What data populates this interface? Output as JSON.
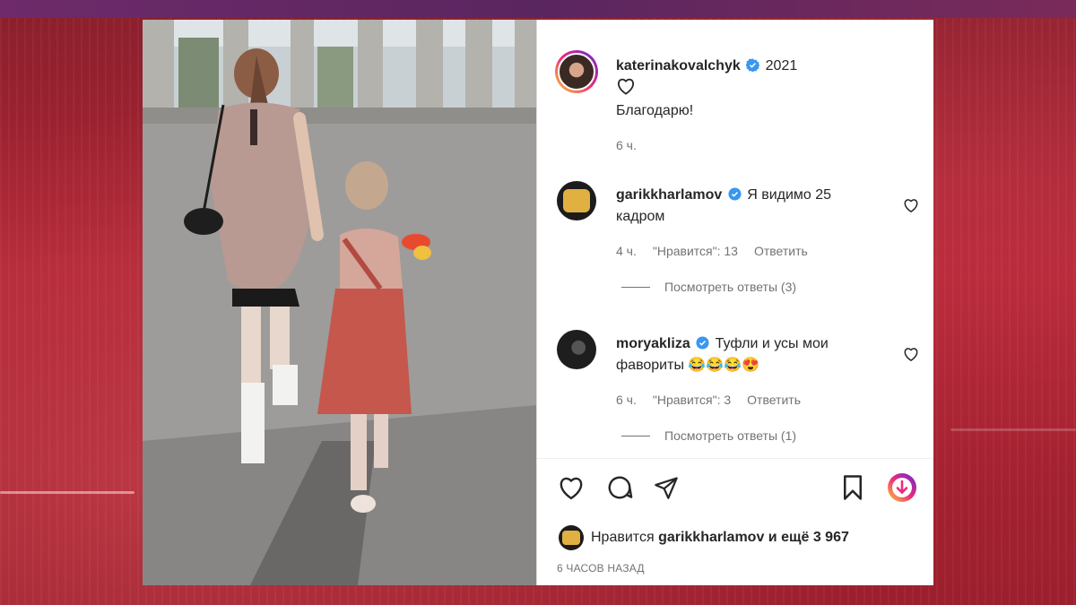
{
  "caption": {
    "username": "katerinakovalchyk",
    "year_text": "2021",
    "text": "Благодарю!",
    "time": "6 ч."
  },
  "comments": [
    {
      "username": "garikkharlamov",
      "text_line1": "Я видимо 25",
      "text_line2": "кадром",
      "time": "4 ч.",
      "likes": "\"Нравится\": 13",
      "reply": "Ответить",
      "view_replies": "Посмотреть ответы (3)"
    },
    {
      "username": "moryakliza",
      "text_line1": "Туфли и усы мои",
      "text_line2": "фавориты 😂😂😂😍",
      "time": "6 ч.",
      "likes": "\"Нравится\": 3",
      "reply": "Ответить",
      "view_replies": "Посмотреть ответы (1)"
    }
  ],
  "likes_bar": {
    "prefix": "Нравится",
    "user": "garikkharlamov",
    "suffix": "и ещё 3 967"
  },
  "timestamp": "6 ЧАСОВ НАЗАД",
  "icons": [
    "like-icon",
    "comment-icon",
    "share-icon",
    "bookmark-icon",
    "download-icon",
    "verified-icon"
  ],
  "colors": {
    "verified": "#3897f0",
    "text": "#262626",
    "muted": "#737373"
  }
}
